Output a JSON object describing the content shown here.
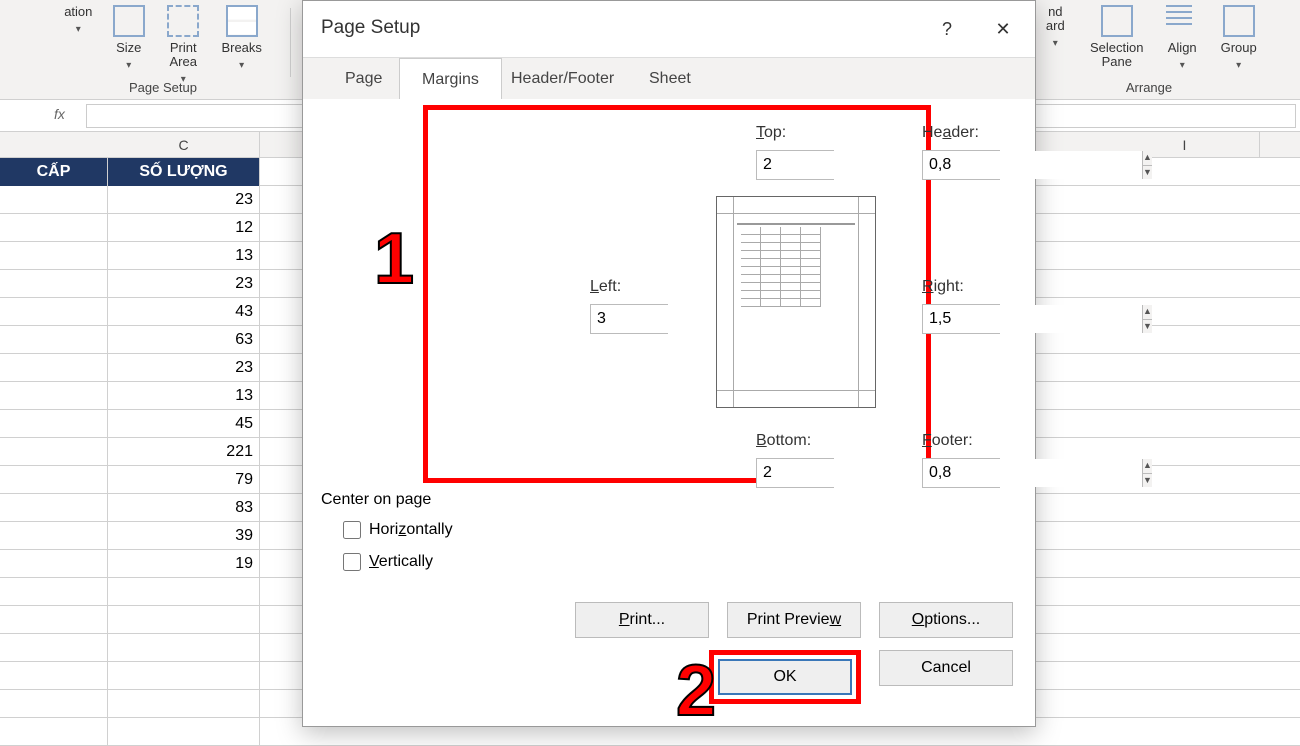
{
  "ribbon": {
    "orientation": "ation",
    "size": "Size",
    "print_area": "Print\nArea",
    "breaks": "Breaks",
    "group_page_setup": "Page Setup",
    "end_cut": "nd\nard",
    "selection_pane": "Selection\nPane",
    "align": "Align",
    "group_cut": "Group",
    "group_arrange": "Arrange"
  },
  "grid": {
    "col_c_header": "C",
    "col_i_header": "I",
    "hdr_b": "CẤP",
    "hdr_c": "SỐ LƯỢNG",
    "values": [
      "23",
      "12",
      "13",
      "23",
      "43",
      "63",
      "23",
      "13",
      "45",
      "221",
      "79",
      "83",
      "39",
      "19"
    ]
  },
  "dialog": {
    "title": "Page Setup",
    "tabs": {
      "page": "Page",
      "margins": "Margins",
      "header_footer": "Header/Footer",
      "sheet": "Sheet"
    },
    "margins": {
      "top_label": "Top:",
      "top_value": "2",
      "header_label": "Header:",
      "header_value": "0,8",
      "left_label": "Left:",
      "left_value": "3",
      "right_label": "Right:",
      "right_value": "1,5",
      "bottom_label": "Bottom:",
      "bottom_value": "2",
      "footer_label": "Footer:",
      "footer_value": "0,8"
    },
    "center_on_page": "Center on page",
    "horizontally": "Horizontally",
    "vertically": "Vertically",
    "btn_print": "Print...",
    "btn_preview": "Print Preview",
    "btn_options": "Options...",
    "btn_ok": "OK",
    "btn_cancel": "Cancel"
  },
  "annotations": {
    "one": "1",
    "two": "2"
  },
  "fx_label": "fx"
}
